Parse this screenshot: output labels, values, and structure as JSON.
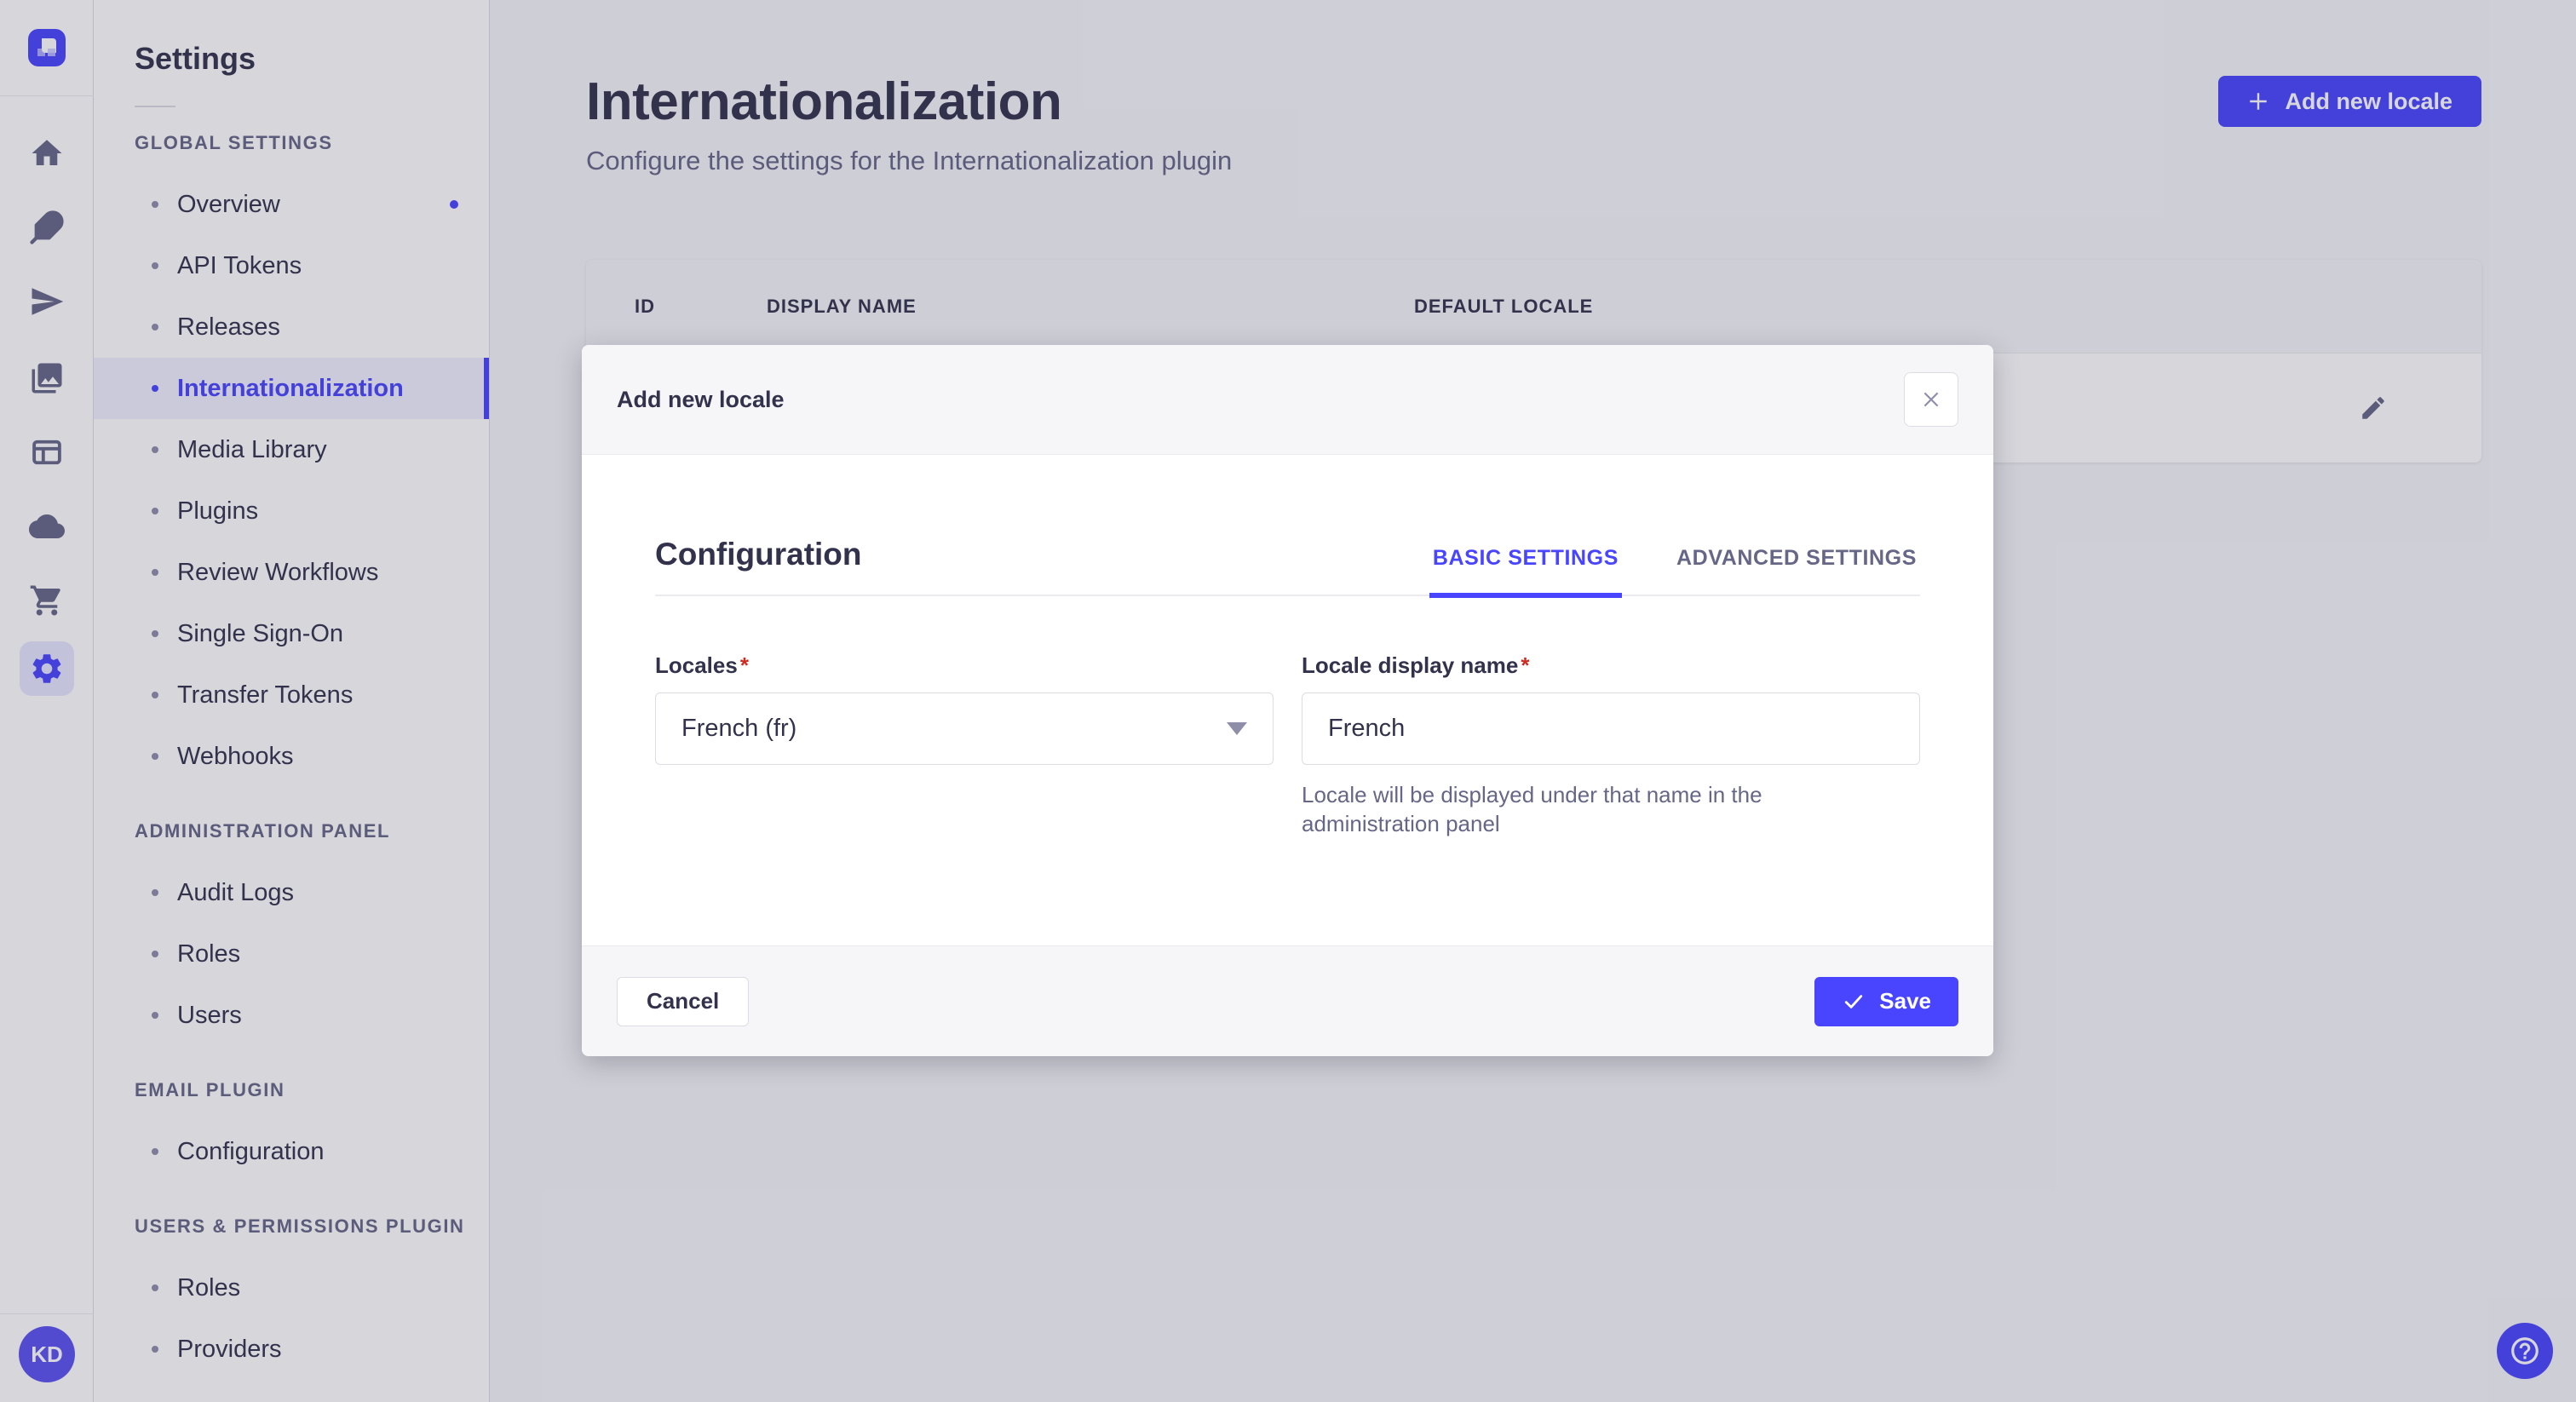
{
  "colors": {
    "accent": "#4945ff",
    "text": "#32324d",
    "muted": "#666687"
  },
  "rail": {
    "avatar_initials": "KD"
  },
  "sidebar": {
    "title": "Settings",
    "sections": [
      {
        "label": "GLOBAL SETTINGS",
        "items": [
          {
            "label": "Overview"
          },
          {
            "label": "API Tokens"
          },
          {
            "label": "Releases"
          },
          {
            "label": "Internationalization"
          },
          {
            "label": "Media Library"
          },
          {
            "label": "Plugins"
          },
          {
            "label": "Review Workflows"
          },
          {
            "label": "Single Sign-On"
          },
          {
            "label": "Transfer Tokens"
          },
          {
            "label": "Webhooks"
          }
        ]
      },
      {
        "label": "ADMINISTRATION PANEL",
        "items": [
          {
            "label": "Audit Logs"
          },
          {
            "label": "Roles"
          },
          {
            "label": "Users"
          }
        ]
      },
      {
        "label": "EMAIL PLUGIN",
        "items": [
          {
            "label": "Configuration"
          }
        ]
      },
      {
        "label": "USERS & PERMISSIONS PLUGIN",
        "items": [
          {
            "label": "Roles"
          },
          {
            "label": "Providers"
          }
        ]
      }
    ]
  },
  "page": {
    "title": "Internationalization",
    "subtitle": "Configure the settings for the Internationalization plugin",
    "add_button": "Add new locale"
  },
  "table": {
    "columns": [
      "ID",
      "DISPLAY NAME",
      "DEFAULT LOCALE"
    ]
  },
  "modal": {
    "title": "Add new locale",
    "section_title": "Configuration",
    "tabs": [
      {
        "label": "BASIC SETTINGS"
      },
      {
        "label": "ADVANCED SETTINGS"
      }
    ],
    "form": {
      "locales": {
        "label": "Locales",
        "required": "*",
        "value": "French (fr)"
      },
      "display_name": {
        "label": "Locale display name",
        "required": "*",
        "value": "French",
        "help": "Locale will be displayed under that name in the administration panel"
      }
    },
    "cancel_label": "Cancel",
    "save_label": "Save"
  }
}
